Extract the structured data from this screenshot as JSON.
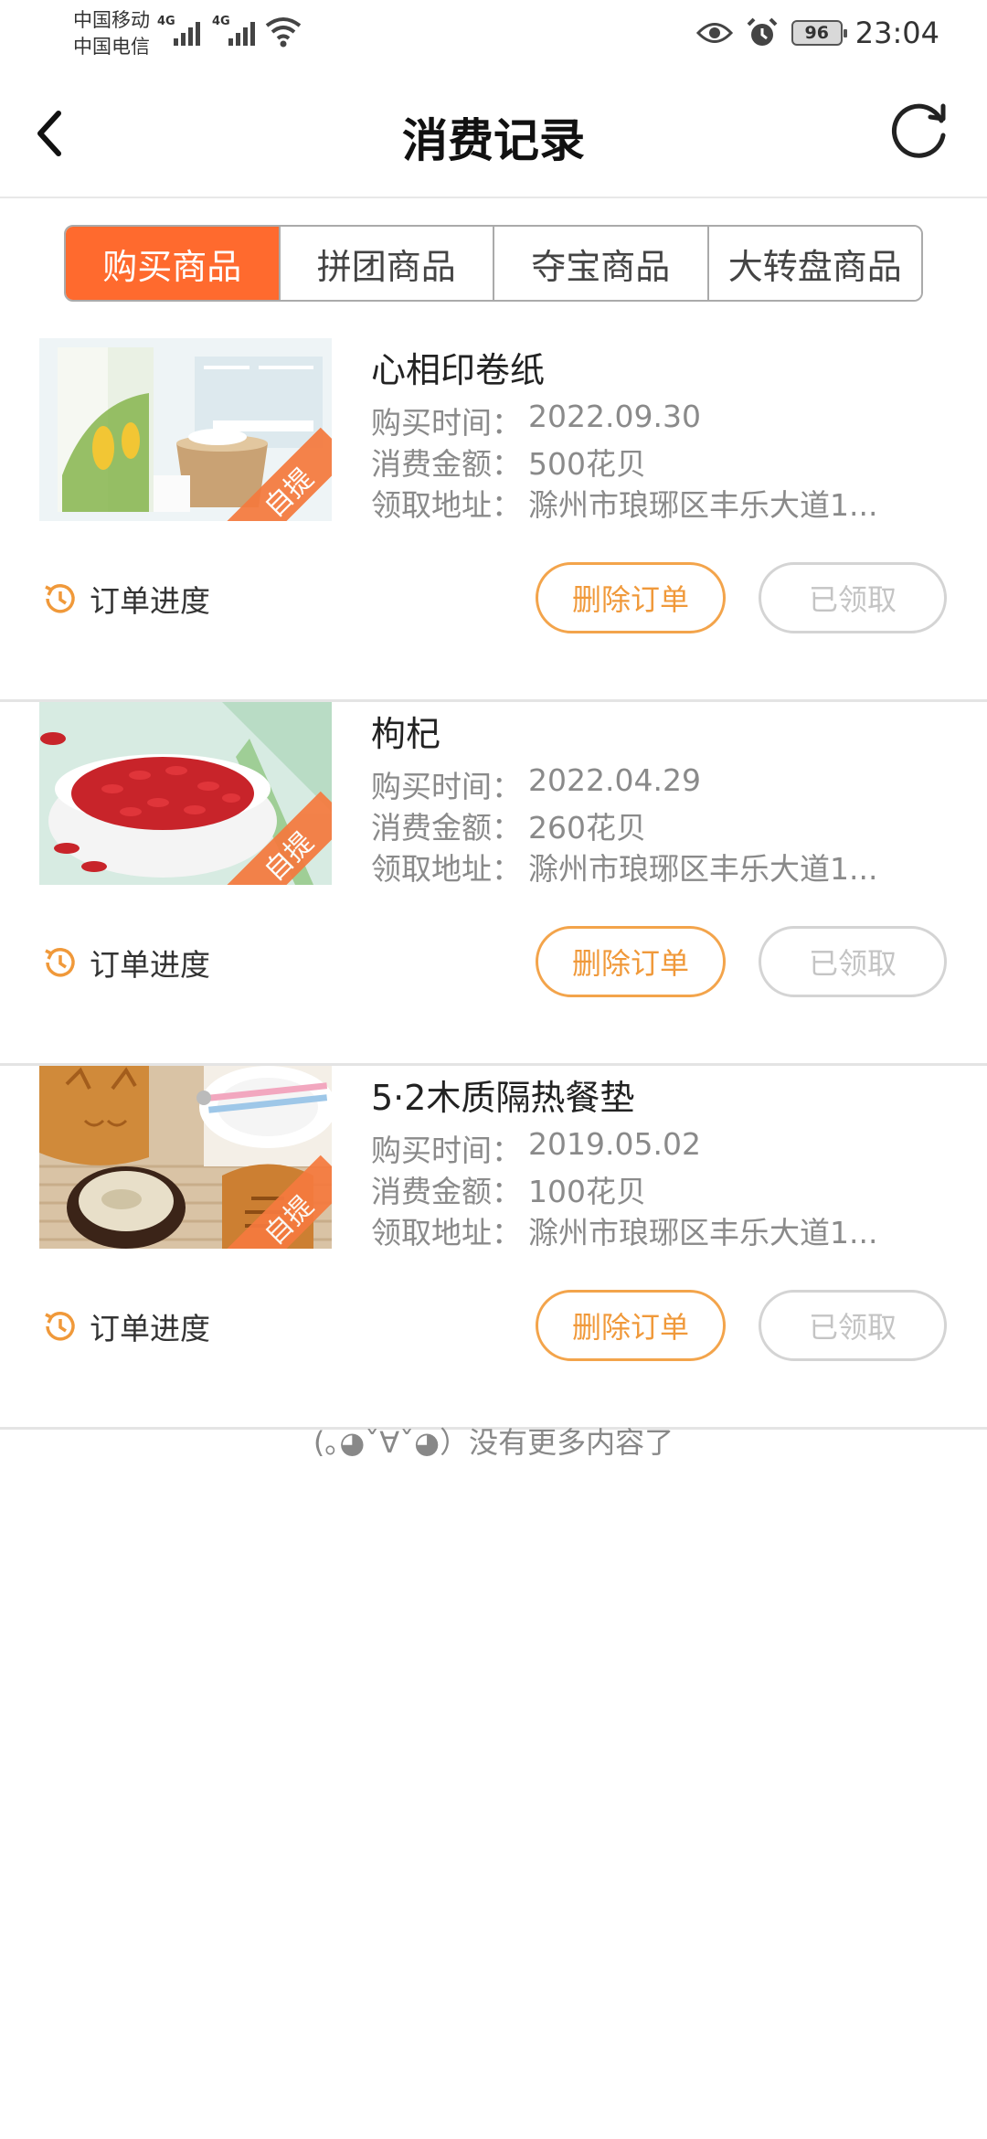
{
  "status_bar": {
    "carrier_1": "中国移动",
    "carrier_2": "中国电信",
    "network_1": "4G",
    "network_2": "4G",
    "battery": "96",
    "time": "23:04"
  },
  "header": {
    "title": "消费记录",
    "back_icon": "chevron-left-icon",
    "refresh_icon": "refresh-icon"
  },
  "tabs": [
    {
      "label": "购买商品",
      "active": true
    },
    {
      "label": "拼团商品",
      "active": false
    },
    {
      "label": "夺宝商品",
      "active": false
    },
    {
      "label": "大转盘商品",
      "active": false
    }
  ],
  "labels": {
    "purchase_time": "购买时间：",
    "amount": "消费金额：",
    "address": "领取地址：",
    "progress": "订单进度",
    "delete": "删除订单",
    "taken": "已领取",
    "badge": "自提"
  },
  "orders": [
    {
      "name": "心相印卷纸",
      "time": "2022.09.30",
      "amount": "500花贝",
      "address": "滁州市琅琊区丰乐大道1..."
    },
    {
      "name": "枸杞",
      "time": "2022.04.29",
      "amount": "260花贝",
      "address": "滁州市琅琊区丰乐大道1..."
    },
    {
      "name": "5·2木质隔热餐垫",
      "time": "2019.05.02",
      "amount": "100花贝",
      "address": "滁州市琅琊区丰乐大道1..."
    }
  ],
  "footer": {
    "no_more": "(｡◕ˇ∀ˇ◕）没有更多内容了"
  },
  "colors": {
    "accent": "#ff6a2e",
    "button_orange": "#f3a44b",
    "muted": "#8a8a8a"
  }
}
